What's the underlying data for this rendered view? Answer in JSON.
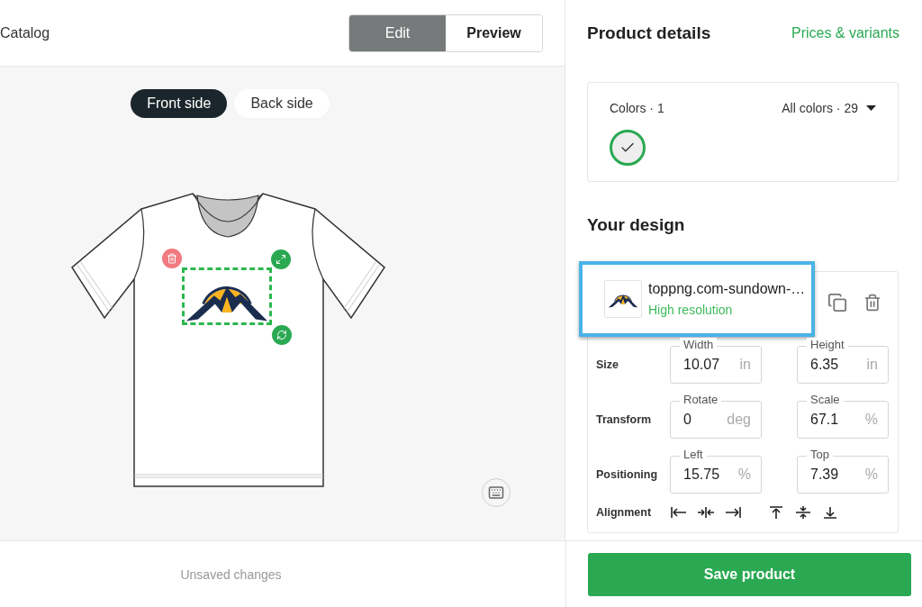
{
  "header": {
    "back_link": "Catalog",
    "mode_tabs": [
      {
        "label": "Edit",
        "selected": true
      },
      {
        "label": "Preview",
        "selected": false
      }
    ]
  },
  "sides": [
    {
      "label": "Front side",
      "selected": true
    },
    {
      "label": "Back side",
      "selected": false
    }
  ],
  "status": "Unsaved changes",
  "panel": {
    "title": "Product details",
    "link": "Prices & variants"
  },
  "colors": {
    "label": "Colors · 1",
    "filter": "All colors · 29",
    "swatches": [
      {
        "color": "#eeeeee",
        "selected": true
      }
    ]
  },
  "design": {
    "title": "Your design",
    "file": {
      "name": "toppng.com-sundown-…",
      "quality": "High resolution",
      "highlighted": true
    },
    "groups": [
      {
        "label": "Size",
        "fields": [
          {
            "label": "Width",
            "value": "10.07",
            "unit": "in"
          },
          {
            "label": "Height",
            "value": "6.35",
            "unit": "in"
          }
        ]
      },
      {
        "label": "Transform",
        "fields": [
          {
            "label": "Rotate",
            "value": "0",
            "unit": "deg"
          },
          {
            "label": "Scale",
            "value": "67.1",
            "unit": "%"
          }
        ]
      },
      {
        "label": "Positioning",
        "fields": [
          {
            "label": "Left",
            "value": "15.75",
            "unit": "%"
          },
          {
            "label": "Top",
            "value": "7.39",
            "unit": "%"
          }
        ]
      }
    ],
    "alignment_label": "Alignment"
  },
  "save_button": "Save product"
}
